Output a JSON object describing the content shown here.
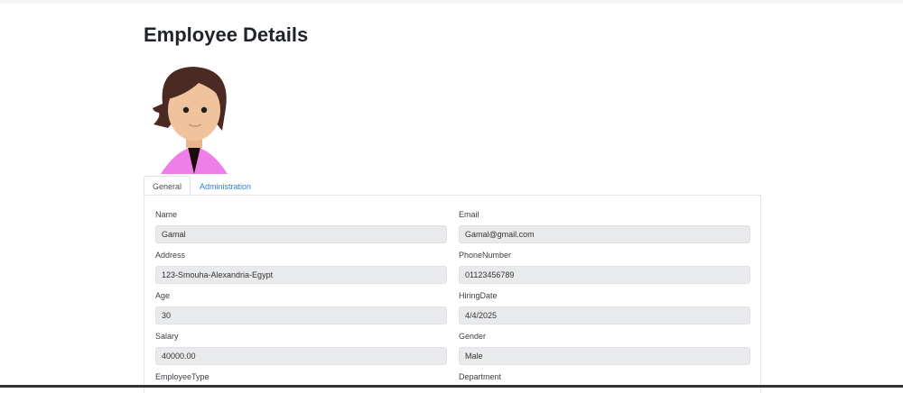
{
  "page_title": "Employee Details",
  "tabs": [
    {
      "label": "General"
    },
    {
      "label": "Administration"
    }
  ],
  "fields": [
    {
      "label": "Name",
      "value": "Gamal"
    },
    {
      "label": "Email",
      "value": "Gamal@gmail.com"
    },
    {
      "label": "Address",
      "value": "123-Smouha-Alexandria-Egypt"
    },
    {
      "label": "PhoneNumber",
      "value": "01123456789"
    },
    {
      "label": "Age",
      "value": "30"
    },
    {
      "label": "HiringDate",
      "value": "4/4/2025"
    },
    {
      "label": "Salary",
      "value": "40000.00"
    },
    {
      "label": "Gender",
      "value": "Male"
    },
    {
      "label": "EmployeeType"
    },
    {
      "label": "Department"
    }
  ]
}
